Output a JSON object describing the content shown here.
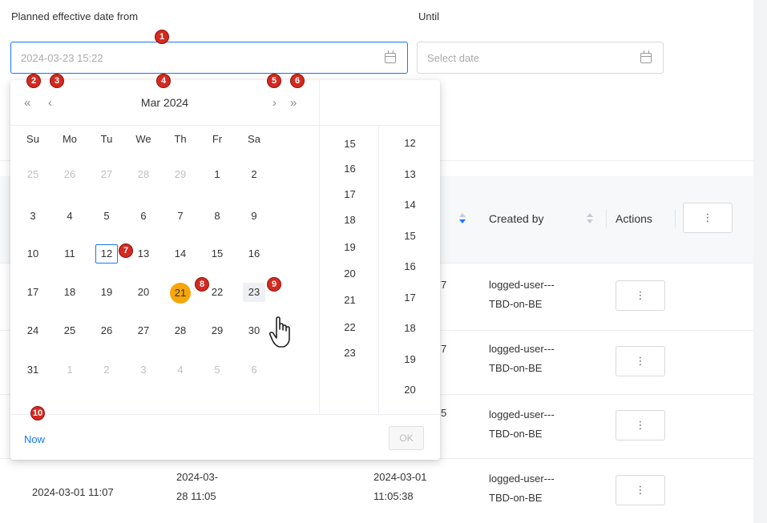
{
  "filters": {
    "from_label": "Planned effective date from",
    "from_value": "2024-03-23 15:22",
    "until_label": "Until",
    "until_placeholder": "Select date"
  },
  "table": {
    "headers": {
      "created_by": "Created by",
      "actions": "Actions"
    },
    "rows": [
      {
        "col3_tail": "7",
        "created_by_line1": "logged-user---",
        "created_by_line2": "TBD-on-BE"
      },
      {
        "col3_tail": "7",
        "created_by_line1": "logged-user---",
        "created_by_line2": "TBD-on-BE"
      },
      {
        "col3_tail": "5",
        "created_by_line1": "logged-user---",
        "created_by_line2": "TBD-on-BE"
      },
      {
        "col1": "2024-03-01 11:07",
        "col2_line1": "2024-03-",
        "col2_line2": "28 11:05",
        "col3_line1": "2024-03-01",
        "col3_line2": "11:05:38",
        "created_by_line1": "logged-user---",
        "created_by_line2": "TBD-on-BE"
      }
    ],
    "kebab_glyph": "⋮"
  },
  "picker": {
    "nav": {
      "prev_year": "«",
      "prev_month": "‹",
      "next_month": "›",
      "next_year": "»"
    },
    "month_label": "Mar",
    "year_label": "2024",
    "weekdays": [
      "Su",
      "Mo",
      "Tu",
      "We",
      "Th",
      "Fr",
      "Sa"
    ],
    "weeks": [
      [
        "25",
        "26",
        "27",
        "28",
        "29",
        "1",
        "2"
      ],
      [
        "3",
        "4",
        "5",
        "6",
        "7",
        "8",
        "9"
      ],
      [
        "10",
        "11",
        "12",
        "13",
        "14",
        "15",
        "16"
      ],
      [
        "17",
        "18",
        "19",
        "20",
        "21",
        "22",
        "23"
      ],
      [
        "24",
        "25",
        "26",
        "27",
        "28",
        "29",
        "30"
      ],
      [
        "31",
        "1",
        "2",
        "3",
        "4",
        "5",
        "6"
      ]
    ],
    "today": "12",
    "selected": "21",
    "hovered": "23",
    "hours": [
      "15",
      "16",
      "17",
      "18",
      "19",
      "20",
      "21",
      "22",
      "23"
    ],
    "minutes": [
      "12",
      "13",
      "14",
      "15",
      "16",
      "17",
      "18",
      "19",
      "20"
    ],
    "now_label": "Now",
    "ok_label": "OK"
  },
  "badges": [
    "1",
    "2",
    "3",
    "4",
    "5",
    "6",
    "7",
    "8",
    "9",
    "10"
  ],
  "colors": {
    "accent": "#1677ff",
    "selected": "#f6a609",
    "badge": "#d42a20"
  }
}
